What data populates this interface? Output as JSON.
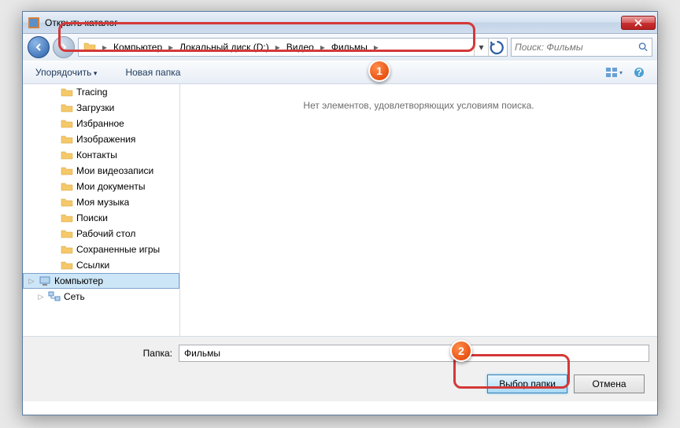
{
  "window": {
    "title": "Открыть каталог"
  },
  "breadcrumb": {
    "items": [
      "Компьютер",
      "Локальный диск (D:)",
      "Видео",
      "Фильмы"
    ]
  },
  "search": {
    "placeholder": "Поиск: Фильмы"
  },
  "toolbar": {
    "organize": "Упорядочить",
    "newfolder": "Новая папка"
  },
  "tree": {
    "items": [
      {
        "label": "Tracing",
        "icon": "folder",
        "indent": 2
      },
      {
        "label": "Загрузки",
        "icon": "folder-dl",
        "indent": 2
      },
      {
        "label": "Избранное",
        "icon": "fav",
        "indent": 2
      },
      {
        "label": "Изображения",
        "icon": "pics",
        "indent": 2
      },
      {
        "label": "Контакты",
        "icon": "contacts",
        "indent": 2
      },
      {
        "label": "Мои видеозаписи",
        "icon": "video",
        "indent": 2
      },
      {
        "label": "Мои документы",
        "icon": "docs",
        "indent": 2
      },
      {
        "label": "Моя музыка",
        "icon": "music",
        "indent": 2
      },
      {
        "label": "Поиски",
        "icon": "search",
        "indent": 2
      },
      {
        "label": "Рабочий стол",
        "icon": "desktop",
        "indent": 2
      },
      {
        "label": "Сохраненные игры",
        "icon": "games",
        "indent": 2
      },
      {
        "label": "Ссылки",
        "icon": "links",
        "indent": 2
      },
      {
        "label": "Компьютер",
        "icon": "computer",
        "indent": 1,
        "selected": true,
        "expandable": true
      },
      {
        "label": "Сеть",
        "icon": "network",
        "indent": 1,
        "expandable": true
      }
    ]
  },
  "filelist": {
    "empty": "Нет элементов, удовлетворяющих условиям поиска."
  },
  "footer": {
    "folder_label": "Папка:",
    "folder_value": "Фильмы",
    "select": "Выбор папки",
    "cancel": "Отмена"
  },
  "badges": {
    "one": "1",
    "two": "2"
  }
}
